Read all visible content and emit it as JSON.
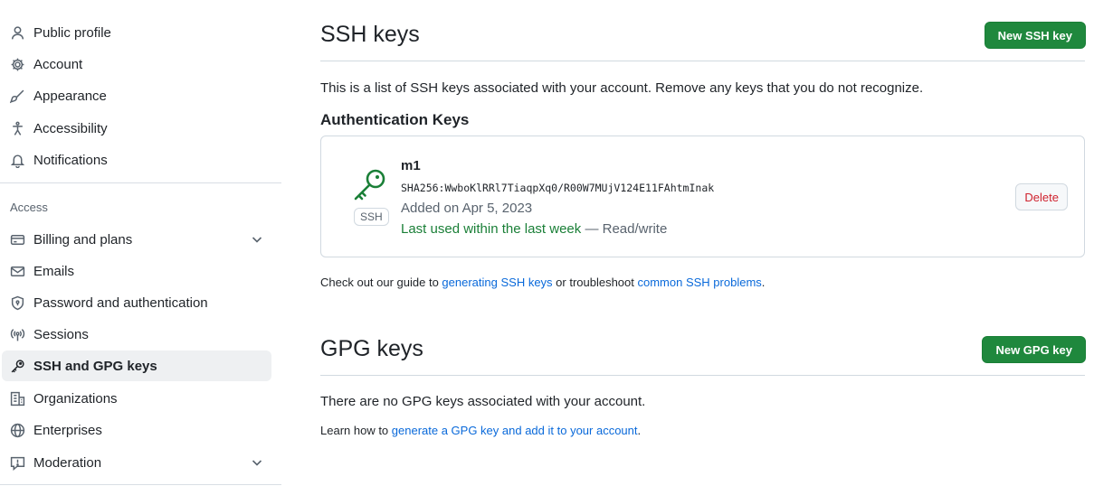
{
  "sidebar": {
    "items_top": [
      {
        "label": "Public profile",
        "icon": "person-icon"
      },
      {
        "label": "Account",
        "icon": "gear-icon"
      },
      {
        "label": "Appearance",
        "icon": "paintbrush-icon"
      },
      {
        "label": "Accessibility",
        "icon": "accessibility-icon"
      },
      {
        "label": "Notifications",
        "icon": "bell-icon"
      }
    ],
    "access_label": "Access",
    "items_access": [
      {
        "label": "Billing and plans",
        "icon": "credit-card-icon"
      },
      {
        "label": "Emails",
        "icon": "mail-icon"
      },
      {
        "label": "Password and authentication",
        "icon": "shield-lock-icon"
      },
      {
        "label": "Sessions",
        "icon": "broadcast-icon"
      },
      {
        "label": "SSH and GPG keys",
        "icon": "key-icon"
      },
      {
        "label": "Organizations",
        "icon": "organization-icon"
      },
      {
        "label": "Enterprises",
        "icon": "globe-icon"
      },
      {
        "label": "Moderation",
        "icon": "report-icon"
      }
    ]
  },
  "ssh": {
    "title": "SSH keys",
    "new_button": "New SSH key",
    "description": "This is a list of SSH keys associated with your account. Remove any keys that you do not recognize.",
    "auth_heading": "Authentication Keys",
    "key": {
      "badge": "SSH",
      "title": "m1",
      "fingerprint": "SHA256:WwboKlRRl7TiaqpXq0/R00W7MUjV124E11FAhtmInak",
      "added": "Added on Apr 5, 2023",
      "last_used": "Last used within the last week",
      "access": "— Read/write",
      "delete_label": "Delete"
    },
    "guide_prefix": "Check out our guide to ",
    "guide_link1": "generating SSH keys",
    "guide_middle": " or troubleshoot ",
    "guide_link2": "common SSH problems",
    "guide_suffix": "."
  },
  "gpg": {
    "title": "GPG keys",
    "new_button": "New GPG key",
    "empty": "There are no GPG keys associated with your account.",
    "learn_prefix": "Learn how to ",
    "learn_link": "generate a GPG key and add it to your account",
    "learn_suffix": "."
  },
  "colors": {
    "primary_button": "#1f883d",
    "link": "#0969da",
    "danger": "#cf222e",
    "success": "#1a7f37"
  }
}
